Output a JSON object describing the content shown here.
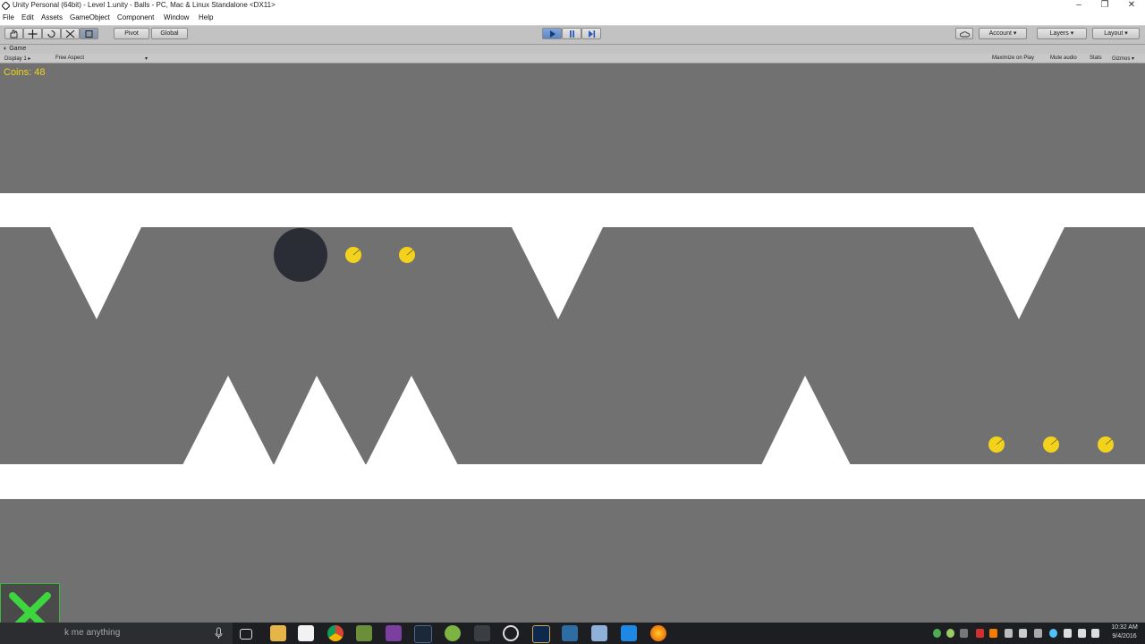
{
  "window": {
    "title": "Unity Personal (64bit) - Level 1.unity - Balls - PC, Mac & Linux Standalone <DX11>",
    "controls": {
      "minimize": "–",
      "maximize": "❐",
      "close": "✕"
    }
  },
  "menu": [
    "File",
    "Edit",
    "Assets",
    "GameObject",
    "Component",
    "Window",
    "Help"
  ],
  "toolbar": {
    "tools": [
      "hand-icon",
      "move-icon",
      "rotate-icon",
      "scale-icon",
      "rect-icon"
    ],
    "pivot_label": "Pivot",
    "global_label": "Global",
    "play_controls": [
      "play-icon",
      "pause-icon",
      "step-icon"
    ],
    "play_active": true,
    "account_label": "Account",
    "layers_label": "Layers",
    "layout_label": "Layout"
  },
  "game_panel": {
    "tab_label": "Game",
    "display_label": "Display 1",
    "aspect_label": "Free Aspect",
    "options": [
      "Maximize on Play",
      "Mute audio",
      "Stats",
      "Gizmos"
    ]
  },
  "game": {
    "coins_text": "Coins: 48",
    "coin_color": "#f2d21c",
    "wall_color": "#ffffff",
    "background_color": "#717171",
    "player_color": "#2a2d35"
  },
  "taskbar": {
    "search_text": "k me anything",
    "apps": [
      "task-view-icon",
      "file-explorer-icon",
      "store-icon",
      "chrome-icon",
      "minecraft-icon",
      "visual-studio-icon",
      "steam-icon",
      "android-icon",
      "unity-icon",
      "obs-icon",
      "league-icon",
      "app-icon",
      "app-icon",
      "app-icon",
      "firefox-icon"
    ],
    "time": "10:32 AM",
    "date": "9/4/2016"
  }
}
